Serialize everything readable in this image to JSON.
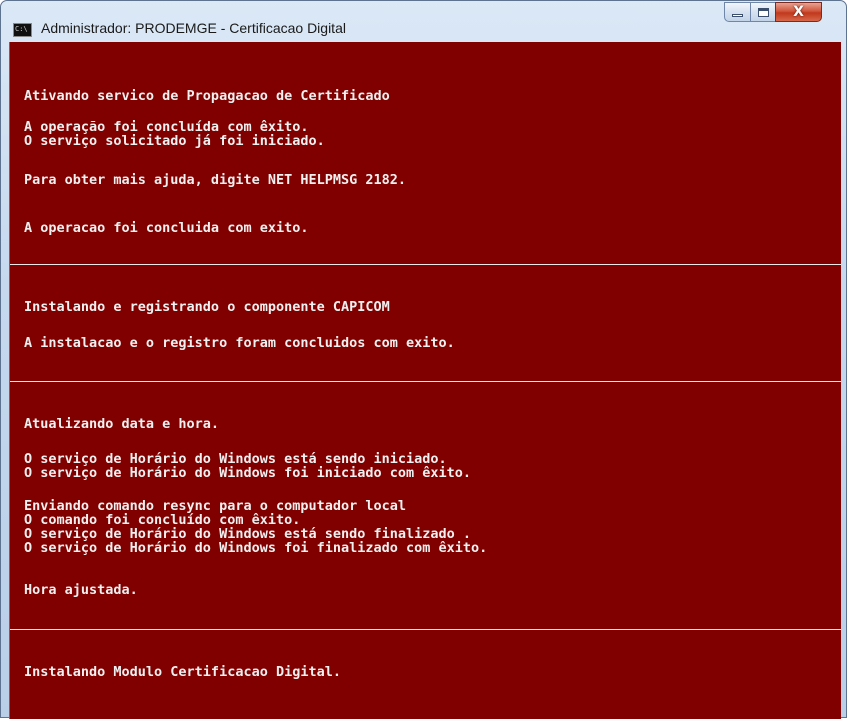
{
  "window": {
    "title": "Administrador:  PRODEMGE - Certificacao Digital",
    "icon": "console-icon",
    "icon_text": "C:\\"
  },
  "controls": {
    "minimize": "minimize-icon",
    "maximize": "maximize-icon",
    "close": "close-icon",
    "close_glyph": "X"
  },
  "console": {
    "background": "#800000",
    "foreground": "#f0f0f0",
    "lines": [
      "Ativando servico de Propagacao de Certificado",
      "A operação foi concluída com êxito.",
      "O serviço solicitado já foi iniciado.",
      "Para obter mais ajuda, digite NET HELPMSG 2182.",
      "A operacao foi concluida com exito.",
      "Instalando e registrando o componente CAPICOM",
      "A instalacao e o registro foram concluidos com exito.",
      "Atualizando data e hora.",
      "O serviço de Horário do Windows está sendo iniciado.",
      "O serviço de Horário do Windows foi iniciado com êxito.",
      "Enviando comando resync para o computador local",
      "O comando foi concluído com êxito.",
      "O serviço de Horário do Windows está sendo finalizado .",
      "O serviço de Horário do Windows foi finalizado com êxito.",
      "Hora ajustada.",
      "Instalando Modulo Certificacao Digital."
    ]
  }
}
